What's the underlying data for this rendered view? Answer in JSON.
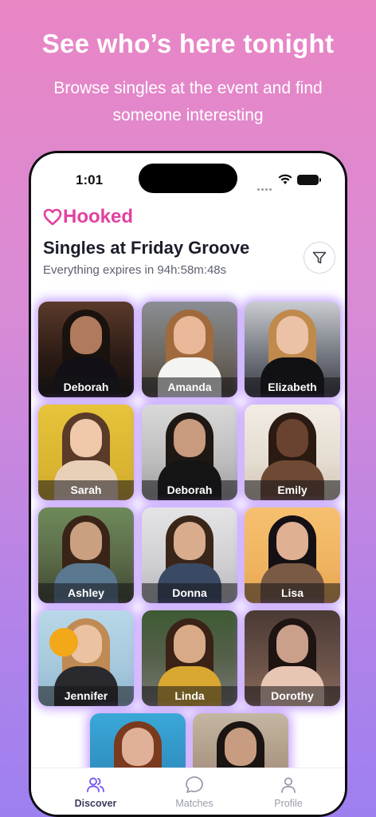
{
  "promo": {
    "headline": "See who’s here tonight",
    "subline": "Browse singles at the event and find someone interesting"
  },
  "status_bar": {
    "time": "1:01"
  },
  "app": {
    "logo_text": "Hooked",
    "brand_color": "#e2419f"
  },
  "header": {
    "title": "Singles at Friday Groove",
    "subtitle": "Everything expires in 94h:58m:48s",
    "filter_icon": "filter-icon"
  },
  "profiles": [
    {
      "name": "Deborah"
    },
    {
      "name": "Amanda"
    },
    {
      "name": "Elizabeth"
    },
    {
      "name": "Sarah"
    },
    {
      "name": "Deborah"
    },
    {
      "name": "Emily"
    },
    {
      "name": "Ashley"
    },
    {
      "name": "Donna"
    },
    {
      "name": "Lisa"
    },
    {
      "name": "Jennifer"
    },
    {
      "name": "Linda"
    },
    {
      "name": "Dorothy"
    }
  ],
  "tabbar": {
    "items": [
      {
        "label": "Discover",
        "icon": "users-icon",
        "active": true
      },
      {
        "label": "Matches",
        "icon": "chat-bubble-icon",
        "active": false
      },
      {
        "label": "Profile",
        "icon": "person-icon",
        "active": false
      }
    ]
  }
}
